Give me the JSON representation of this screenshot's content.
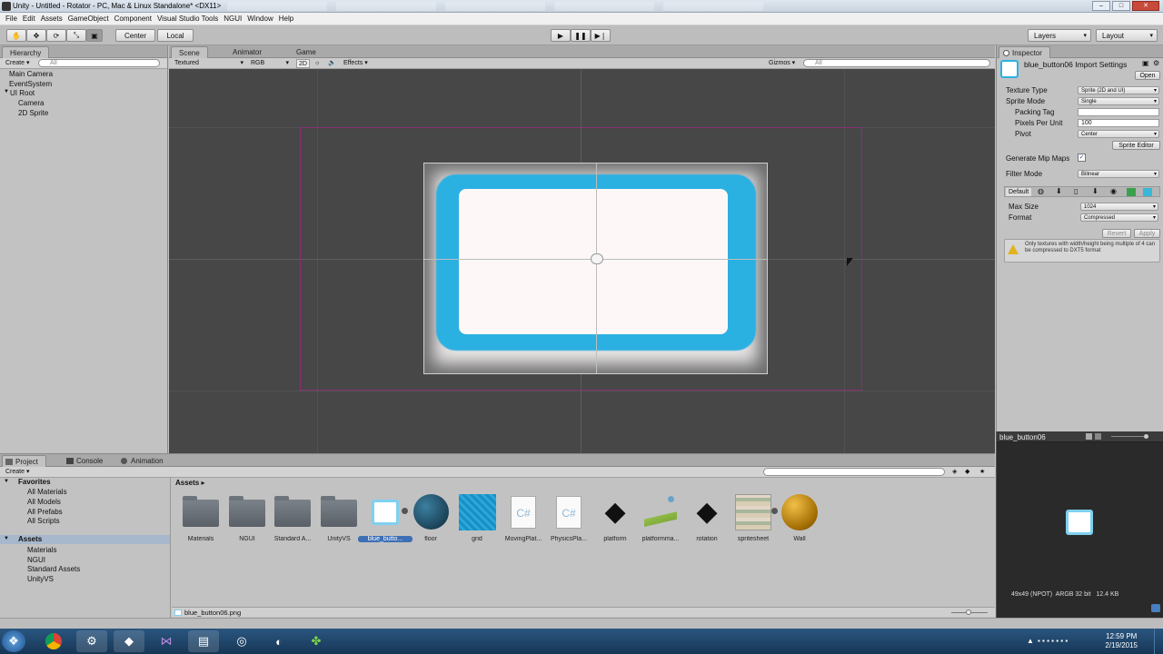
{
  "window": {
    "title": "Unity - Untitled - Rotator - PC, Mac & Linux Standalone* <DX11>"
  },
  "menubar": [
    "File",
    "Edit",
    "Assets",
    "GameObject",
    "Component",
    "Visual Studio Tools",
    "NGUI",
    "Window",
    "Help"
  ],
  "toolbar": {
    "pivot_label": "Center",
    "space_label": "Local",
    "layers_label": "Layers",
    "layout_label": "Layout"
  },
  "hierarchy": {
    "tab": "Hierarchy",
    "create_label": "Create",
    "search_placeholder": "All",
    "items": [
      "Main Camera",
      "EventSystem",
      "UI Root",
      "Camera",
      "2D Sprite"
    ]
  },
  "scene": {
    "tabs": [
      "Scene",
      "Animator",
      "Game"
    ],
    "shading": "Textured",
    "render": "RGB",
    "mode2d": "2D",
    "effects": "Effects",
    "gizmos": "Gizmos",
    "search_placeholder": "All"
  },
  "inspector": {
    "tab": "Inspector",
    "title": "blue_button06 Import Settings",
    "open_label": "Open",
    "fields": {
      "texture_type_label": "Texture Type",
      "texture_type_value": "Sprite (2D and UI)",
      "sprite_mode_label": "Sprite Mode",
      "sprite_mode_value": "Single",
      "packing_tag_label": "Packing Tag",
      "packing_tag_value": "",
      "pixels_per_unit_label": "Pixels Per Unit",
      "pixels_per_unit_value": "100",
      "pivot_label": "Pivot",
      "pivot_value": "Center",
      "sprite_editor_label": "Sprite Editor",
      "mipmaps_label": "Generate Mip Maps",
      "filter_mode_label": "Filter Mode",
      "filter_mode_value": "Bilinear",
      "default_tab": "Default",
      "max_size_label": "Max Size",
      "max_size_value": "1024",
      "format_label": "Format",
      "format_value": "Compressed",
      "revert_label": "Revert",
      "apply_label": "Apply"
    },
    "warning": "Only textures with width/height being multiple of 4 can be compressed to DXT5 format"
  },
  "preview": {
    "title": "blue_button06",
    "info": "49x49 (NPOT)  ARGB 32 bit   12.4 KB"
  },
  "project": {
    "tabs": [
      "Project",
      "Console",
      "Animation"
    ],
    "create_label": "Create",
    "favorites_label": "Favorites",
    "favorites": [
      "All Materials",
      "All Models",
      "All Prefabs",
      "All Scripts"
    ],
    "assets_label": "Assets",
    "asset_tree": [
      "Materials",
      "NGUI",
      "Standard Assets",
      "UnityVS"
    ],
    "breadcrumb": "Assets ▸",
    "grid": [
      "Materials",
      "NGUI",
      "Standard A...",
      "UnityVS",
      "blue_butto...",
      "floor",
      "grid",
      "MovingPlat...",
      "PhysicsPla...",
      "platform",
      "platformma...",
      "rotation",
      "spritesheet",
      "Wall"
    ],
    "selected_file": "blue_button06.png"
  },
  "clock": {
    "time": "12:59 PM",
    "date": "2/19/2015"
  }
}
